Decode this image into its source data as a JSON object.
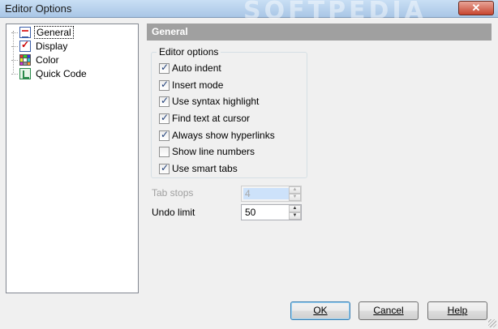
{
  "window": {
    "title": "Editor Options",
    "watermark": "SOFTPEDIA",
    "close_symbol": "✕"
  },
  "tree": {
    "items": [
      {
        "label": "General",
        "icon": "general-settings-icon",
        "selected": true
      },
      {
        "label": "Display",
        "icon": "display-checklist-icon",
        "selected": false
      },
      {
        "label": "Color",
        "icon": "color-grid-icon",
        "selected": false
      },
      {
        "label": "Quick Code",
        "icon": "quick-code-icon",
        "selected": false
      }
    ]
  },
  "panel": {
    "header": "General"
  },
  "editor_options": {
    "title": "Editor options",
    "checkboxes": [
      {
        "label": "Auto indent",
        "checked": true
      },
      {
        "label": "Insert mode",
        "checked": true
      },
      {
        "label": "Use syntax highlight",
        "checked": true
      },
      {
        "label": "Find text at cursor",
        "checked": true
      },
      {
        "label": "Always show hyperlinks",
        "checked": true
      },
      {
        "label": "Show line numbers",
        "checked": false
      },
      {
        "label": "Use smart tabs",
        "checked": true
      }
    ]
  },
  "fields": {
    "tab_stops": {
      "label": "Tab stops",
      "value": "4",
      "enabled": false
    },
    "undo_limit": {
      "label": "Undo limit",
      "value": "50",
      "enabled": true
    }
  },
  "buttons": {
    "ok": "OK",
    "cancel": "Cancel",
    "help": "Help"
  },
  "colors": {
    "header_bg": "#a0a0a0",
    "titlebar": "#b9d1ea",
    "face": "#f0f0f0"
  }
}
